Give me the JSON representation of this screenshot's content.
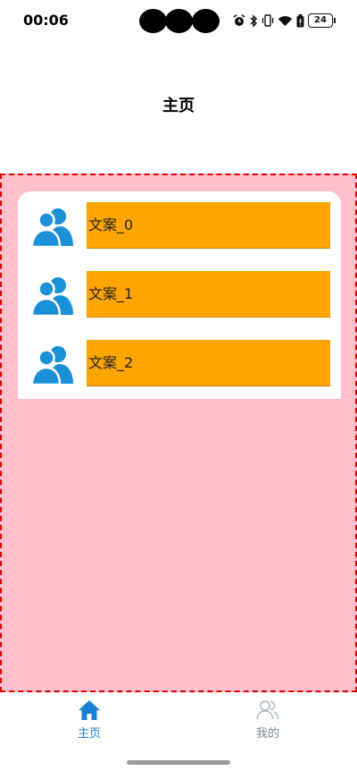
{
  "status_bar": {
    "time": "00:06",
    "battery_level": "24",
    "icons": [
      "alarm-icon",
      "bluetooth-icon",
      "vibrate-icon",
      "wifi-icon",
      "battery-saver-icon",
      "battery-icon"
    ]
  },
  "header": {
    "title": "主页"
  },
  "list": {
    "items": [
      {
        "label": "文案_0",
        "icon": "users-icon"
      },
      {
        "label": "文案_1",
        "icon": "users-icon"
      },
      {
        "label": "文案_2",
        "icon": "users-icon"
      }
    ]
  },
  "tabs": [
    {
      "label": "主页",
      "icon": "home-icon",
      "selected": true
    },
    {
      "label": "我的",
      "icon": "user-icon",
      "selected": false
    }
  ],
  "colors": {
    "content_background": "#ffc0cb",
    "content_border": "#e00000",
    "item_background": "#ffa500",
    "icon_blue": "#1a90d8",
    "tab_active": "#1a7fd6",
    "tab_inactive": "#7a8a96"
  }
}
